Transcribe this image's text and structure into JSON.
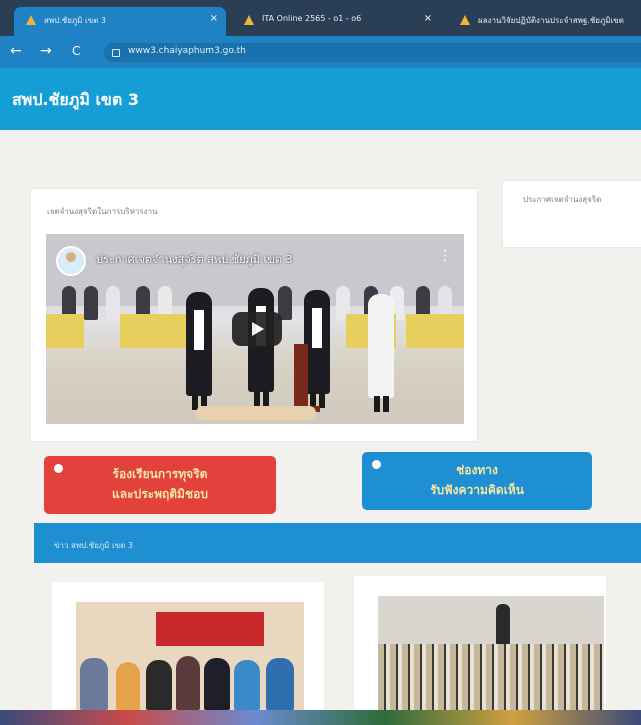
{
  "browser": {
    "tabs": [
      {
        "title": "สพป.ชัยภูมิ เขต 3",
        "active": true
      },
      {
        "title": "ITA Online 2565 - o1 - o6",
        "active": false
      },
      {
        "title": "ผลงานวิจัยปฏิบัติงานประจำสพฐ.ชัยภูมิเขต",
        "active": false
      }
    ],
    "tab_close_glyph": "×",
    "address": "www3.chaiyaphum3.go.th",
    "back_glyph": "←",
    "forward_glyph": "→",
    "reload_glyph": "C"
  },
  "site": {
    "title": "สพป.ชัยภูมิ เขต 3",
    "header_color": "#159ed6"
  },
  "video_panel": {
    "title": "เจตจำนงสุจริตในการบริหารงาน",
    "video_title": "ประกาศเจตจำนงสุจริต สพป.ชัยภูมิ เขต 3",
    "kebab": "⋮"
  },
  "side_panel": {
    "title": "ประกาศเจตจำนงสุจริต"
  },
  "buttons": {
    "complaint": {
      "line1": "ร้องเรียนการทุจริต",
      "line2": "และประพฤติมิชอบ",
      "color": "#e2413c"
    },
    "feedback": {
      "line1": "ช่องทาง",
      "line2": "รับฟังความคิดเห็น",
      "color": "#1f8fd4"
    }
  },
  "news": {
    "title": "ข่าว สพป.ชัยภูมิ เขต 3",
    "bar_color": "#1e8fd0"
  }
}
